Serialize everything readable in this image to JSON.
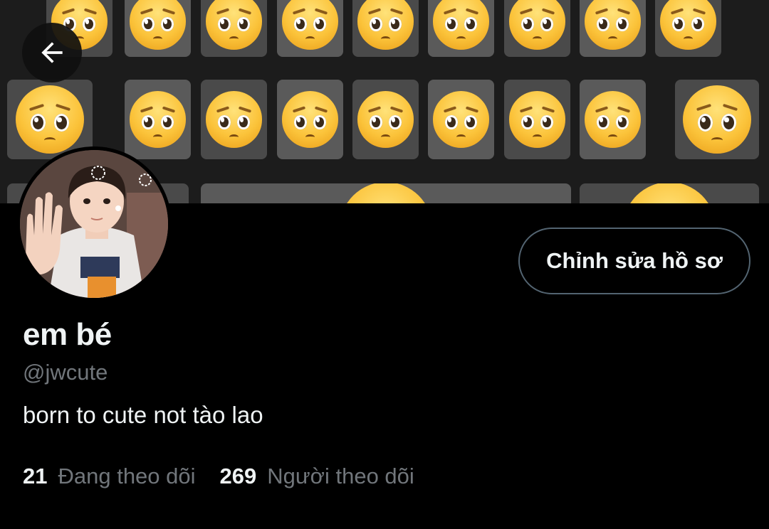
{
  "header": {
    "back_icon": "arrow-left-icon",
    "banner_description": "emoji-keyboard-banner"
  },
  "profile": {
    "display_name": "em bé",
    "handle": "@jwcute",
    "bio": "born to cute not tào lao",
    "edit_button_label": "Chỉnh sửa hồ sơ"
  },
  "stats": {
    "following_count": "21",
    "following_label": "Đang theo dõi",
    "followers_count": "269",
    "followers_label": "Người theo dõi"
  },
  "colors": {
    "background": "#000000",
    "primary_text": "#eff3f4",
    "secondary_text": "#71767b",
    "button_border": "#536471"
  }
}
